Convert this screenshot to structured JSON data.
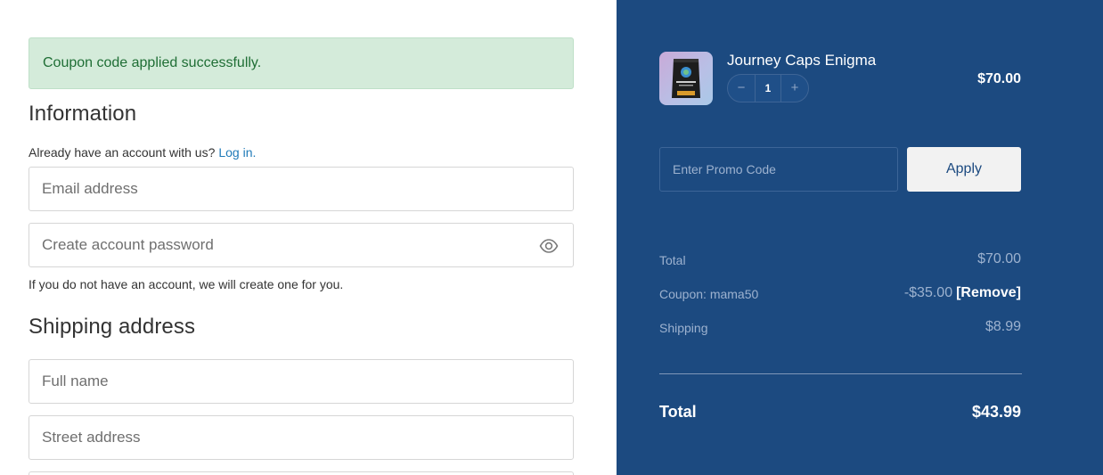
{
  "alert": {
    "message": "Coupon code applied successfully."
  },
  "information": {
    "heading": "Information",
    "account_prompt": "Already have an account with us?",
    "login_link": "Log in.",
    "email_placeholder": "Email address",
    "password_placeholder": "Create account password",
    "password_toggle_icon": "eye-icon",
    "hint": "If you do not have an account, we will create one for you."
  },
  "shipping": {
    "heading": "Shipping address",
    "fullname_placeholder": "Full name",
    "street_placeholder": "Street address"
  },
  "cart": {
    "product": {
      "name": "Journey Caps Enigma",
      "quantity": "1",
      "decrement_label": "−",
      "increment_label": "+",
      "price": "$70.00"
    },
    "promo": {
      "placeholder": "Enter Promo Code",
      "apply_label": "Apply"
    },
    "summary": {
      "total_label": "Total",
      "total_value": "$70.00",
      "coupon_label": "Coupon: mama50",
      "coupon_value": "-$35.00",
      "remove_label": "[Remove]",
      "shipping_label": "Shipping",
      "shipping_value": "$8.99",
      "grand_label": "Total",
      "grand_value": "$43.99"
    }
  },
  "colors": {
    "panel_bg": "#1c4a80",
    "alert_bg": "#d4ebda",
    "alert_text": "#1f6e35",
    "link": "#1f7ab8"
  }
}
